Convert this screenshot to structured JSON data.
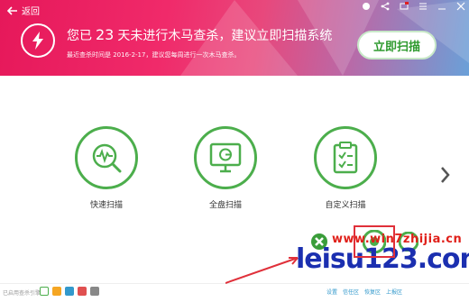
{
  "header": {
    "back_label": "返回",
    "headline_prefix": "您已",
    "days": "23",
    "headline_suffix": "天未进行木马查杀，建议立即扫描系统",
    "subtext": "最近查杀时间是 2016-2-17，建议您每周进行一次木马查杀。",
    "scan_button": "立即扫描"
  },
  "options": [
    {
      "label": "快速扫描",
      "icon": "pulse-icon"
    },
    {
      "label": "全盘扫描",
      "icon": "monitor-icon"
    },
    {
      "label": "自定义扫描",
      "icon": "custom-checklist-icon"
    }
  ],
  "footer": {
    "enabled_label": "已启用查杀引擎：",
    "links": [
      "设置",
      "信任区",
      "恢复区",
      "上报区"
    ]
  },
  "watermark": {
    "top": "www.win7zhijia.cn",
    "bottom": "leisu123.com"
  },
  "colors": {
    "accent_green": "#4cae4c",
    "banner_pink": "#e6185a",
    "link_blue": "#3399cc"
  }
}
